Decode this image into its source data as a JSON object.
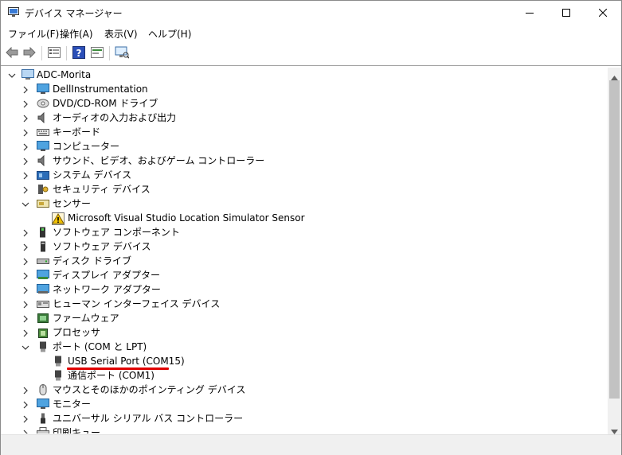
{
  "window": {
    "title": "デバイス マネージャー",
    "minimize_icon": "minimize-icon",
    "maximize_icon": "maximize-icon",
    "close_icon": "close-icon"
  },
  "menu": [
    "ファイル(F)",
    "操作(A)",
    "表示(V)",
    "ヘルプ(H)"
  ],
  "toolbar": [
    "back-arrow-icon",
    "forward-arrow-icon",
    "properties-icon",
    "help-icon",
    "update-driver-icon",
    "scan-hardware-icon"
  ],
  "tree": {
    "root": "ADC-Morita",
    "items": [
      {
        "label": "DellInstrumentation",
        "icon": "monitor-icon",
        "expanded": false
      },
      {
        "label": "DVD/CD-ROM ドライブ",
        "icon": "disc-icon",
        "expanded": false
      },
      {
        "label": "オーディオの入力および出力",
        "icon": "speaker-icon",
        "expanded": false
      },
      {
        "label": "キーボード",
        "icon": "keyboard-icon",
        "expanded": false
      },
      {
        "label": "コンピューター",
        "icon": "computer-icon",
        "expanded": false
      },
      {
        "label": "サウンド、ビデオ、およびゲーム コントローラー",
        "icon": "speaker-icon",
        "expanded": false
      },
      {
        "label": "システム デバイス",
        "icon": "system-folder-icon",
        "expanded": false
      },
      {
        "label": "セキュリティ デバイス",
        "icon": "security-key-icon",
        "expanded": false
      },
      {
        "label": "センサー",
        "icon": "sensor-icon",
        "expanded": true
      },
      {
        "label": "Microsoft Visual Studio Location Simulator Sensor",
        "icon": "warning-sensor-icon",
        "child": true
      },
      {
        "label": "ソフトウェア コンポーネント",
        "icon": "software-component-icon",
        "expanded": false
      },
      {
        "label": "ソフトウェア デバイス",
        "icon": "software-device-icon",
        "expanded": false
      },
      {
        "label": "ディスク ドライブ",
        "icon": "disk-drive-icon",
        "expanded": false
      },
      {
        "label": "ディスプレイ アダプター",
        "icon": "display-adapter-icon",
        "expanded": false
      },
      {
        "label": "ネットワーク アダプター",
        "icon": "network-adapter-icon",
        "expanded": false
      },
      {
        "label": "ヒューマン インターフェイス デバイス",
        "icon": "hid-icon",
        "expanded": false
      },
      {
        "label": "ファームウェア",
        "icon": "firmware-icon",
        "expanded": false
      },
      {
        "label": "プロセッサ",
        "icon": "processor-icon",
        "expanded": false
      },
      {
        "label": "ポート (COM と LPT)",
        "icon": "port-icon",
        "expanded": true
      },
      {
        "label": "USB Serial Port (COM15)",
        "icon": "port-icon",
        "child": true
      },
      {
        "label": "通信ポート (COM1)",
        "icon": "port-icon",
        "child": true
      },
      {
        "label": "マウスとそのほかのポインティング デバイス",
        "icon": "mouse-icon",
        "expanded": false
      },
      {
        "label": "モニター",
        "icon": "monitor-icon",
        "expanded": false
      },
      {
        "label": "ユニバーサル シリアル バス コントローラー",
        "icon": "usb-icon",
        "expanded": false
      },
      {
        "label": "印刷キュー",
        "icon": "printer-icon",
        "expanded": false
      }
    ]
  },
  "highlight_color": "#e00000"
}
